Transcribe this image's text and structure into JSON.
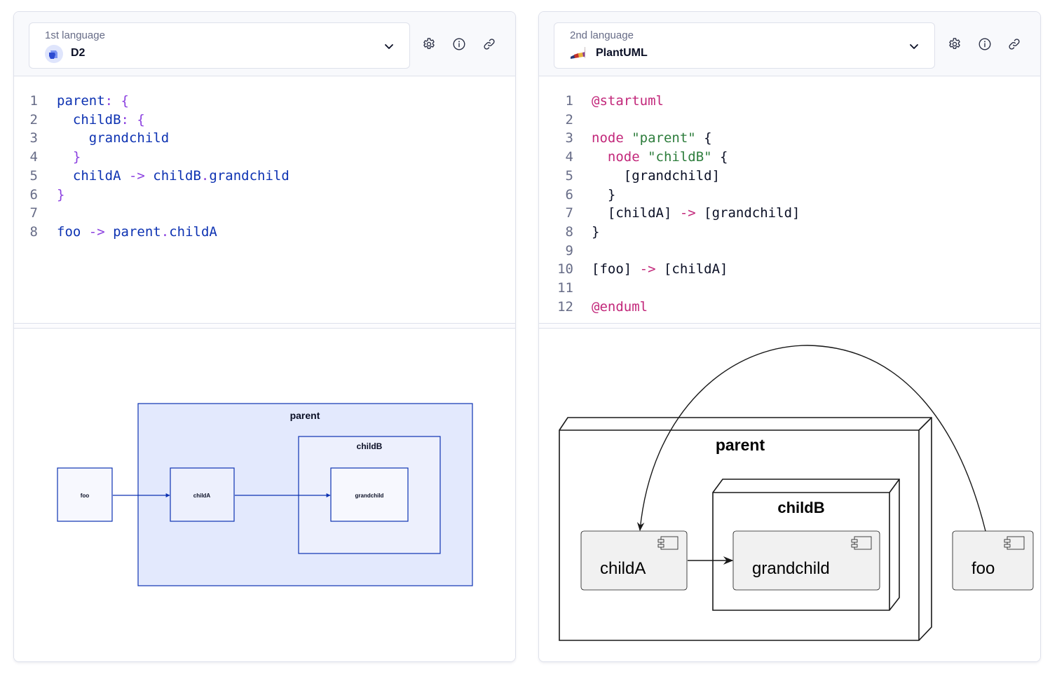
{
  "panels": [
    {
      "id": "left",
      "label": "1st language",
      "language": "D2",
      "language_icon": "d2-logo-icon",
      "actions": [
        {
          "name": "settings",
          "icon": "gear-icon"
        },
        {
          "name": "info",
          "icon": "info-icon"
        },
        {
          "name": "link",
          "icon": "link-icon"
        }
      ],
      "code_lines": [
        {
          "n": "1",
          "tokens": [
            {
              "t": "parent",
              "c": "d2-id"
            },
            {
              "t": ": {",
              "c": "d2-punc"
            }
          ]
        },
        {
          "n": "2",
          "tokens": [
            {
              "t": "  childB",
              "c": "d2-id"
            },
            {
              "t": ": {",
              "c": "d2-punc"
            }
          ]
        },
        {
          "n": "3",
          "tokens": [
            {
              "t": "    grandchild",
              "c": "d2-id"
            }
          ]
        },
        {
          "n": "4",
          "tokens": [
            {
              "t": "  }",
              "c": "d2-punc"
            }
          ]
        },
        {
          "n": "5",
          "tokens": [
            {
              "t": "  childA ",
              "c": "d2-id"
            },
            {
              "t": "->",
              "c": "d2-punc"
            },
            {
              "t": " childB",
              "c": "d2-id"
            },
            {
              "t": ".",
              "c": "d2-punc"
            },
            {
              "t": "grandchild",
              "c": "d2-id"
            }
          ]
        },
        {
          "n": "6",
          "tokens": [
            {
              "t": "}",
              "c": "d2-punc"
            }
          ]
        },
        {
          "n": "7",
          "tokens": []
        },
        {
          "n": "8",
          "tokens": [
            {
              "t": "foo ",
              "c": "d2-id"
            },
            {
              "t": "->",
              "c": "d2-punc"
            },
            {
              "t": " parent",
              "c": "d2-id"
            },
            {
              "t": ".",
              "c": "d2-punc"
            },
            {
              "t": "childA",
              "c": "d2-id"
            }
          ]
        }
      ],
      "diagram": {
        "nodes": {
          "parent": "parent",
          "childB": "childB",
          "childA": "childA",
          "grandchild": "grandchild",
          "foo": "foo"
        },
        "edges": [
          {
            "from": "foo",
            "to": "childA"
          },
          {
            "from": "childA",
            "to": "grandchild"
          }
        ],
        "colors": {
          "stroke": "#0d32b2",
          "parent_fill": "#e3e9fd",
          "childB_fill": "#edf0fd",
          "leaf_fill": "#f7f8fe",
          "edge": "#0d32b2"
        }
      }
    },
    {
      "id": "right",
      "label": "2nd language",
      "language": "PlantUML",
      "language_icon": "plantuml-logo-icon",
      "actions": [
        {
          "name": "settings",
          "icon": "gear-icon"
        },
        {
          "name": "info",
          "icon": "info-icon"
        },
        {
          "name": "link",
          "icon": "link-icon"
        }
      ],
      "code_lines": [
        {
          "n": "1",
          "tokens": [
            {
              "t": "@startuml",
              "c": "pu-kw"
            }
          ]
        },
        {
          "n": "2",
          "tokens": []
        },
        {
          "n": "3",
          "tokens": [
            {
              "t": "node ",
              "c": "pu-kw"
            },
            {
              "t": "\"parent\"",
              "c": "pu-str"
            },
            {
              "t": " {",
              "c": "pu-txt"
            }
          ]
        },
        {
          "n": "4",
          "tokens": [
            {
              "t": "  node ",
              "c": "pu-kw"
            },
            {
              "t": "\"childB\"",
              "c": "pu-str"
            },
            {
              "t": " {",
              "c": "pu-txt"
            }
          ]
        },
        {
          "n": "5",
          "tokens": [
            {
              "t": "    [grandchild]",
              "c": "pu-txt"
            }
          ]
        },
        {
          "n": "6",
          "tokens": [
            {
              "t": "  }",
              "c": "pu-txt"
            }
          ]
        },
        {
          "n": "7",
          "tokens": [
            {
              "t": "  [childA] ",
              "c": "pu-txt"
            },
            {
              "t": "->",
              "c": "pu-kw"
            },
            {
              "t": " [grandchild]",
              "c": "pu-txt"
            }
          ]
        },
        {
          "n": "8",
          "tokens": [
            {
              "t": "}",
              "c": "pu-txt"
            }
          ]
        },
        {
          "n": "9",
          "tokens": []
        },
        {
          "n": "10",
          "tokens": [
            {
              "t": "[foo] ",
              "c": "pu-txt"
            },
            {
              "t": "->",
              "c": "pu-kw"
            },
            {
              "t": " [childA]",
              "c": "pu-txt"
            }
          ]
        },
        {
          "n": "11",
          "tokens": []
        },
        {
          "n": "12",
          "tokens": [
            {
              "t": "@enduml",
              "c": "pu-kw"
            }
          ]
        }
      ],
      "diagram": {
        "nodes": {
          "parent": "parent",
          "childB": "childB",
          "childA": "childA",
          "grandchild": "grandchild",
          "foo": "foo"
        },
        "edges": [
          {
            "from": "childA",
            "to": "grandchild"
          },
          {
            "from": "foo",
            "to": "childA"
          }
        ],
        "colors": {
          "stroke": "#181818",
          "component_fill": "#f1f1f1",
          "node_fill": "#ffffff"
        }
      }
    }
  ]
}
